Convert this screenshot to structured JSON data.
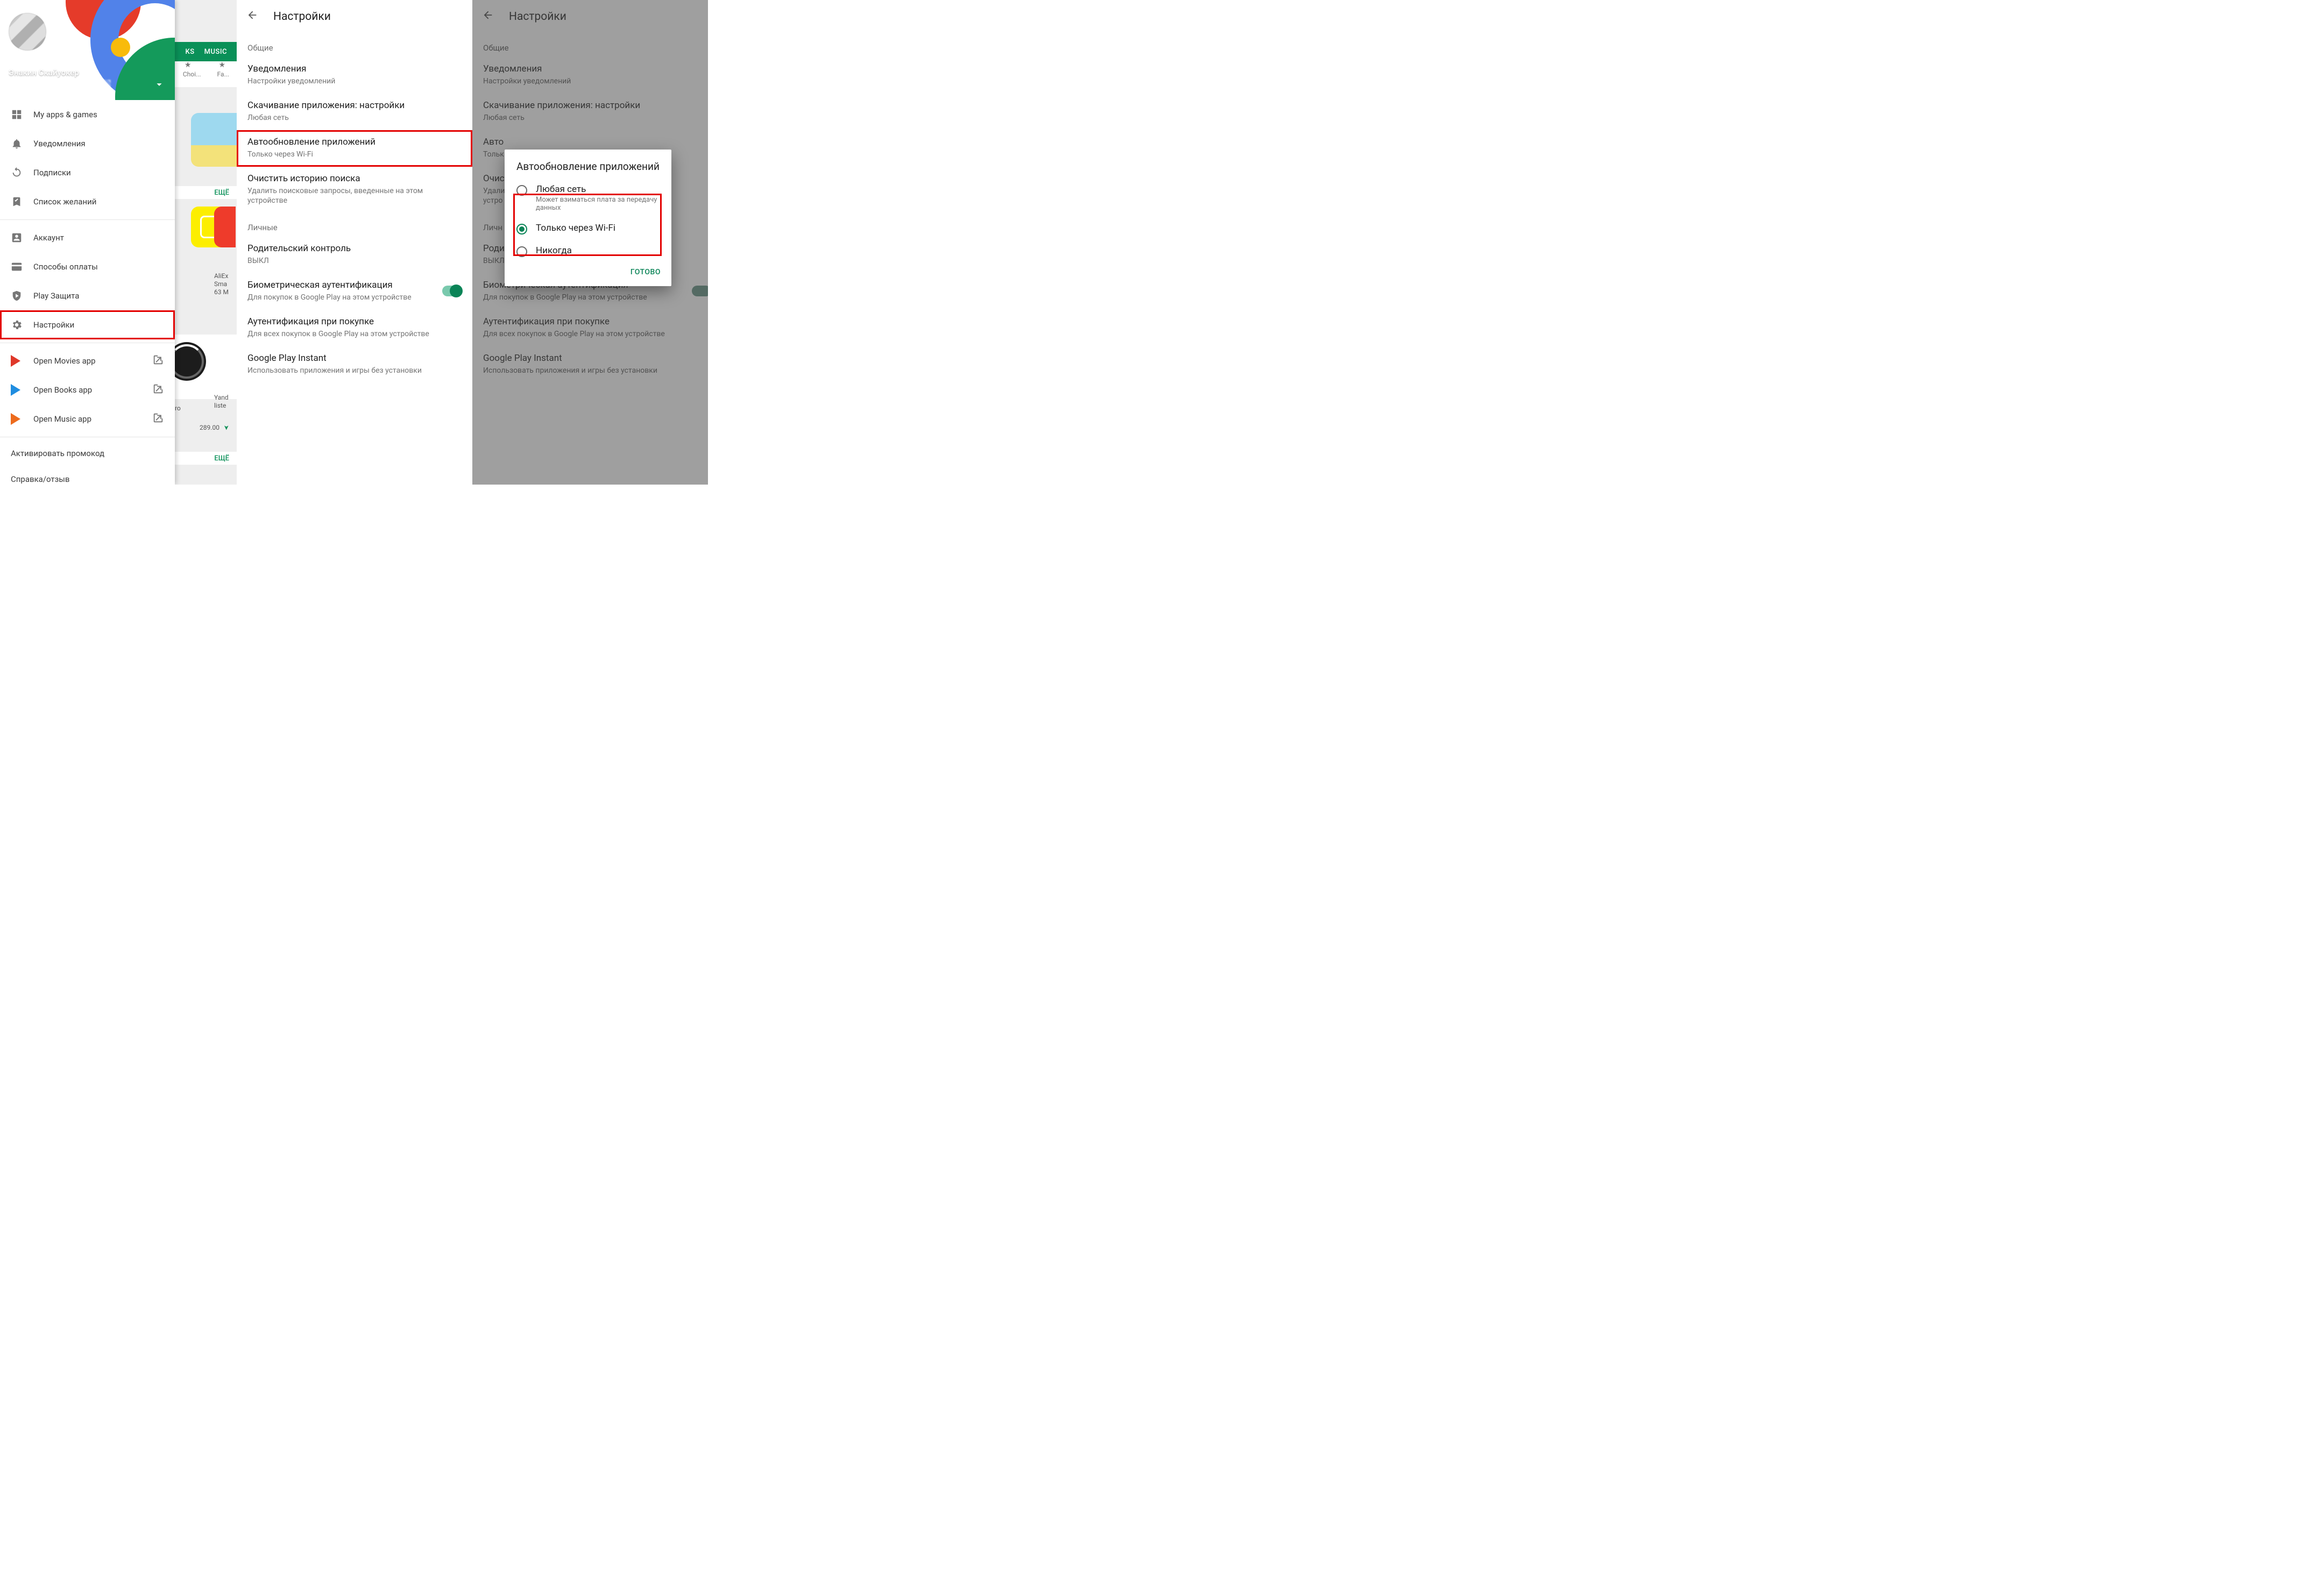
{
  "store": {
    "tabs": {
      "ks": "KS",
      "music": "MUSIC"
    },
    "subheader": {
      "choice": "Choi...",
      "family": "Fa..."
    },
    "row1_more": "ЕЩЁ",
    "card_ali": {
      "line1": "AliEx",
      "line2": "Sma",
      "line3": "63 M"
    },
    "card_yandex": {
      "line1": "Yand",
      "line2": "liste"
    },
    "card_ro": "ro",
    "price": "289.00",
    "row2_more": "ЕЩЁ"
  },
  "drawer": {
    "user": "Энакин Скайуокер",
    "items": {
      "myapps": "My apps & games",
      "notif": "Уведомления",
      "subs": "Подписки",
      "wishlist": "Список желаний",
      "account": "Аккаунт",
      "payment": "Способы оплаты",
      "protect": "Play Защита",
      "settings": "Настройки",
      "movies": "Open Movies app",
      "books": "Open Books app",
      "music": "Open Music app",
      "promo": "Активировать промокод",
      "help": "Справка/отзыв"
    }
  },
  "settings": {
    "title": "Настройки",
    "general": "Общие",
    "notif_t": "Уведомления",
    "notif_s": "Настройки уведомлений",
    "download_t": "Скачивание приложения: настройки",
    "download_s": "Любая сеть",
    "auto_t": "Автообновление приложений",
    "auto_s": "Только через Wi-Fi",
    "clear_t": "Очистить историю поиска",
    "clear_s": "Удалить поисковые запросы, введенные на этом устройстве",
    "personal": "Личные",
    "parent_t": "Родительский контроль",
    "parent_s": "ВЫКЛ",
    "bio_t": "Биометрическая аутентификация",
    "bio_s": "Для покупок в Google Play на этом устройстве",
    "auth_t": "Аутентификация при покупке",
    "auth_s": "Для всех покупок в Google Play на этом устройстве",
    "instant_t": "Google Play Instant",
    "instant_s": "Использовать приложения и игры без установки"
  },
  "settings3": {
    "auto_t_short": "Авто",
    "auto_s_short": "Тольк",
    "clear_t_short": "Очист",
    "clear_s_short": "Удали",
    "clear_s_short2": "устро",
    "personal_short": "Личн",
    "parent_t_short": "Роди",
    "parent_s_short": "ВЫКЛ"
  },
  "dialog": {
    "title": "Автообновление приложений",
    "opt1_t": "Любая сеть",
    "opt1_s": "Может взиматься плата за передачу данных",
    "opt2_t": "Только через Wi-Fi",
    "opt3_t": "Никогда",
    "done": "ГОТОВО"
  }
}
